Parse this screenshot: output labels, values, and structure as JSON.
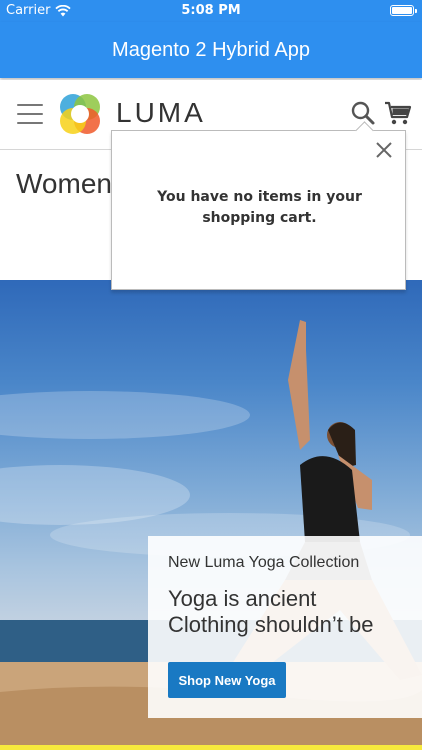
{
  "status_bar": {
    "carrier": "Carrier",
    "time": "5:08 PM"
  },
  "app_bar": {
    "title": "Magento 2 Hybrid App",
    "color": "#2e8fef"
  },
  "header": {
    "logo_text": "LUMA",
    "menu_icon": "hamburger-menu-icon",
    "search_icon": "search-icon",
    "cart_icon": "cart-icon"
  },
  "page": {
    "title": "Women"
  },
  "minicart": {
    "message": "You have no items in your shopping cart.",
    "close_icon": "close-icon"
  },
  "promo": {
    "kicker": "New Luma Yoga Collection",
    "title": "Yoga is ancient\nClothing shouldn’t be",
    "button_label": "Shop New Yoga",
    "button_color": "#1979c3"
  }
}
